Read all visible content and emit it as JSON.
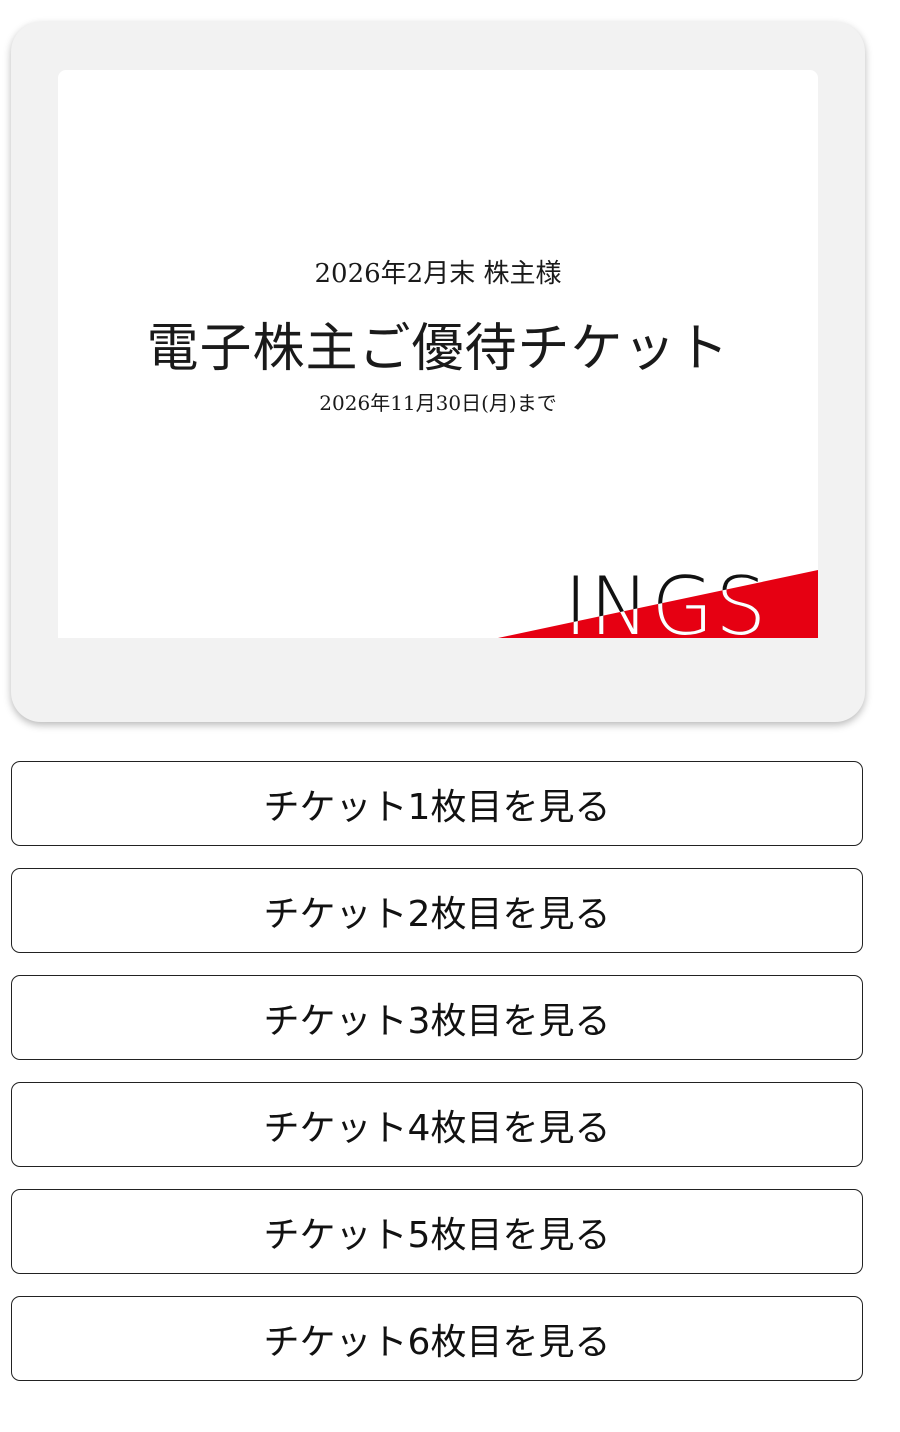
{
  "ticket": {
    "subtitle": "2026年2月末 株主様",
    "title": "電子株主ご優待チケット",
    "expiry": "2026年11月30日(月)まで",
    "logo_text": "INGS",
    "logo_accent_color": "#e60012"
  },
  "buttons": [
    {
      "label": "チケット1枚目を見る"
    },
    {
      "label": "チケット2枚目を見る"
    },
    {
      "label": "チケット3枚目を見る"
    },
    {
      "label": "チケット4枚目を見る"
    },
    {
      "label": "チケット5枚目を見る"
    },
    {
      "label": "チケット6枚目を見る"
    }
  ]
}
